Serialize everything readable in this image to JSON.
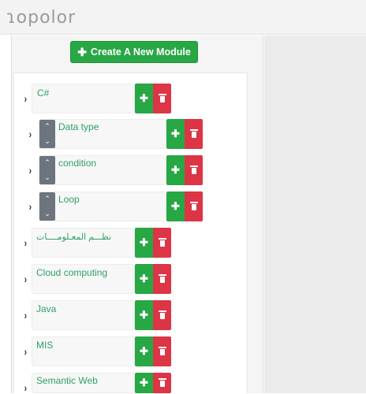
{
  "app": {
    "logo_text": "ɿopolor"
  },
  "toolbar": {
    "create_plus": "✚",
    "create_label": "Create A New Module"
  },
  "icons": {
    "add": "plus-icon",
    "delete": "trash-icon",
    "expand": "chevron-right-icon",
    "reorder": "up-down-arrow-icon"
  },
  "colors": {
    "green": "#28a745",
    "red": "#dc3545",
    "gray": "#6c757d",
    "module_text": "#2ea069"
  },
  "modules": [
    {
      "name": "C#"
    },
    {
      "name": "Data type"
    },
    {
      "name": "condition"
    },
    {
      "name": "Loop"
    },
    {
      "name": "نظـــم المعـلومــــات"
    },
    {
      "name": "Cloud computing"
    },
    {
      "name": "Java"
    },
    {
      "name": "MIS"
    },
    {
      "name": "Semantic Web"
    }
  ],
  "glyphs": {
    "plus": "✚",
    "chevron": "›",
    "up": "⌃",
    "down": "⌄"
  }
}
